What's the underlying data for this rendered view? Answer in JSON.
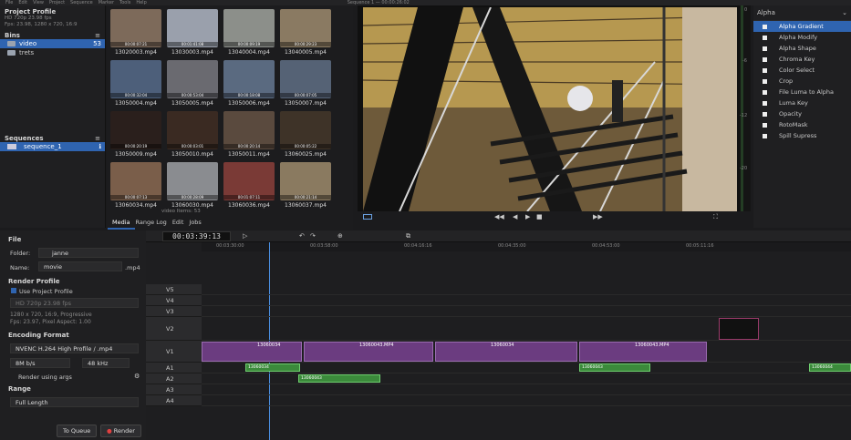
{
  "menubar": {
    "items": [
      "File",
      "Edit",
      "View",
      "Project",
      "Sequence",
      "Marker",
      "Tools",
      "Help"
    ],
    "title": "Sequence 1 — 00:00:26:02"
  },
  "project": {
    "title": "Project Profile",
    "profile": "HD 720p 23.98 fps",
    "details": "Fps: 23.98, 1280 x 720, 16:9"
  },
  "bins": {
    "title": "Bins",
    "items": [
      {
        "name": "video",
        "count": "53"
      },
      {
        "name": "trets",
        "count": ""
      }
    ]
  },
  "sequences": {
    "title": "Sequences",
    "items": [
      {
        "name": "sequence_1"
      }
    ]
  },
  "media": {
    "clips": [
      {
        "name": "13020003.mp4",
        "tc": "00:00:07:21",
        "c": "#7d6a5a"
      },
      {
        "name": "13030003.mp4",
        "tc": "00:01:41:08",
        "c": "#9aa0ac"
      },
      {
        "name": "13040004.mp4",
        "tc": "00:00:09:19",
        "c": "#8c8f8a"
      },
      {
        "name": "13040005.mp4",
        "tc": "00:00:29:23",
        "c": "#8a7a62"
      },
      {
        "name": "13050004.mp4",
        "tc": "00:00:32:04",
        "c": "#4d5f7a"
      },
      {
        "name": "13050005.mp4",
        "tc": "00:00:53:04",
        "c": "#6a6a70"
      },
      {
        "name": "13050006.mp4",
        "tc": "00:00:18:08",
        "c": "#5a6a80"
      },
      {
        "name": "13050007.mp4",
        "tc": "00:00:07:05",
        "c": "#556275"
      },
      {
        "name": "13050009.mp4",
        "tc": "00:00:20:19",
        "c": "#2a1f1c"
      },
      {
        "name": "13050010.mp4",
        "tc": "00:00:03:01",
        "c": "#3a2a22"
      },
      {
        "name": "13050011.mp4",
        "tc": "00:00:20:14",
        "c": "#5a4a3e"
      },
      {
        "name": "13060025.mp4",
        "tc": "00:00:05:22",
        "c": "#3e3328"
      },
      {
        "name": "13060034.mp4",
        "tc": "00:00:07:13",
        "c": "#7a5e4a"
      },
      {
        "name": "13060030.mp4",
        "tc": "00:00:28:09",
        "c": "#8a8c90"
      },
      {
        "name": "13060036.mp4",
        "tc": "00:01:07:11",
        "c": "#7a3a36"
      },
      {
        "name": "13060037.mp4",
        "tc": "00:00:21:14",
        "c": "#8a7a60"
      }
    ],
    "footer": "video  Items: 53"
  },
  "bottom_tabs": [
    "Media",
    "Range Log",
    "Edit",
    "Jobs"
  ],
  "effects": {
    "category": "Alpha",
    "items": [
      "Alpha Gradient",
      "Alpha Modify",
      "Alpha Shape",
      "Chroma Key",
      "Color Select",
      "Crop",
      "File Luma to Alpha",
      "Luma Key",
      "Opacity",
      "RotoMask",
      "Spill Supress"
    ]
  },
  "meter": {
    "ticks": [
      "0",
      "-6",
      "-12",
      "-20"
    ]
  },
  "render": {
    "file_title": "File",
    "folder_label": "Folder:",
    "folder": "janne",
    "name_label": "Name:",
    "name": "movie",
    "ext": ".mp4",
    "profile_title": "Render Profile",
    "use_project": "Use Project Profile",
    "profile_select": "HD 720p 23.98 fps",
    "profile_info1": "1280 x 720, 16:9, Progressive",
    "profile_info2": "Fps: 23.97, Pixel Aspect: 1.00",
    "enc_title": "Encoding Format",
    "encoder": "NVENC H.264 High Profile / .mp4",
    "bitrate": "8M b/s",
    "samplerate": "48 kHz",
    "render_args": "Render using args",
    "range_title": "Range",
    "range": "Full Length",
    "queue_btn": "To Queue",
    "render_btn": "Render"
  },
  "timeline": {
    "timecode": "00:03:39:13",
    "ruler": [
      "00:03:30:00",
      "00:03:58:00",
      "00:04:16:16",
      "00:04:35:00",
      "00:04:53:00",
      "00:05:11:16"
    ],
    "tracks": [
      "V5",
      "V4",
      "V3",
      "V2",
      "V1",
      "A1",
      "A2",
      "A3",
      "A4"
    ],
    "v1_clips": [
      "13060034",
      "13060043.MP4",
      "13060034",
      "13060043.MP4"
    ],
    "a_clips": [
      "13060034",
      "13060043",
      "13060043",
      "13060044"
    ]
  }
}
